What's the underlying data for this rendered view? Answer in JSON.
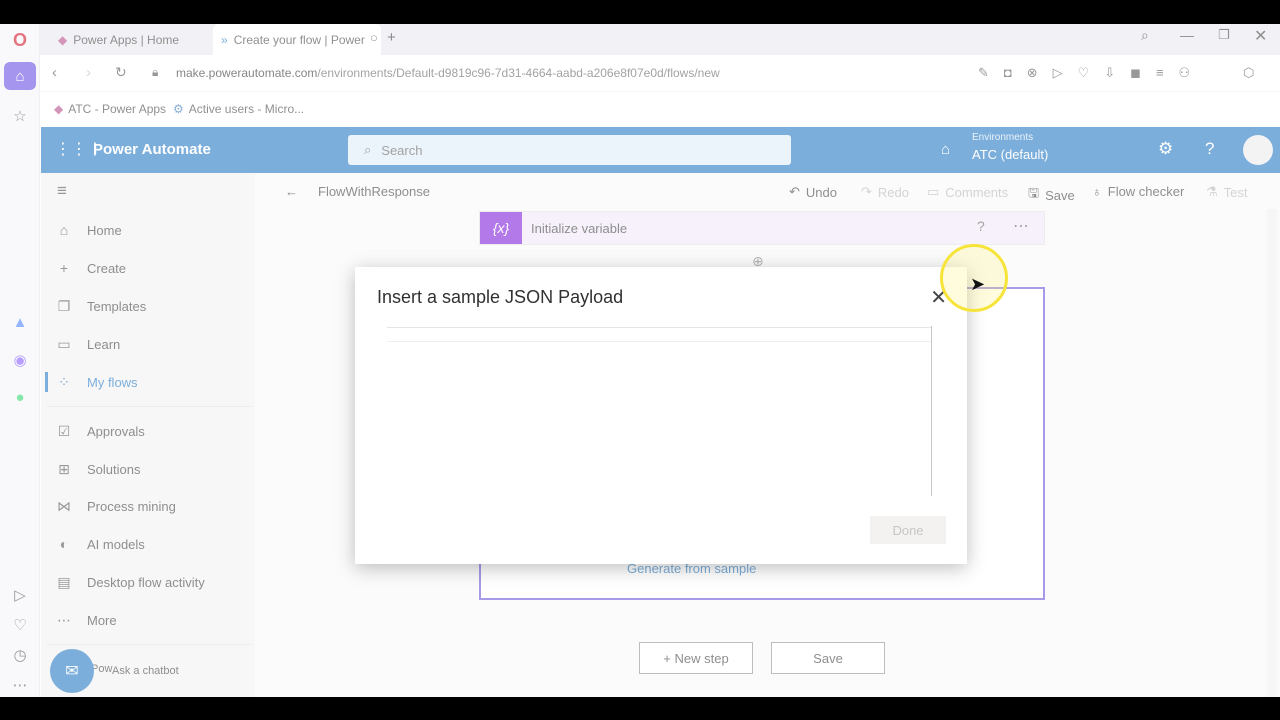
{
  "browser": {
    "tabs": [
      {
        "label": "Power Apps | Home"
      },
      {
        "label": "Create your flow | Power"
      }
    ],
    "url_domain": "make.powerautomate.com",
    "url_path": "/environments/Default-d9819c96-7d31-4664-aabd-a206e8f07e0d/flows/new",
    "bookmarks": [
      {
        "label": "ATC - Power Apps"
      },
      {
        "label": "Active users - Micro..."
      }
    ]
  },
  "header": {
    "app_name": "Power Automate",
    "search_placeholder": "Search",
    "env_label": "Environments",
    "env_value": "ATC (default)"
  },
  "nav": {
    "items": [
      {
        "label": "Home"
      },
      {
        "label": "Create"
      },
      {
        "label": "Templates"
      },
      {
        "label": "Learn"
      },
      {
        "label": "My flows"
      },
      {
        "label": "Approvals"
      },
      {
        "label": "Solutions"
      },
      {
        "label": "Process mining"
      },
      {
        "label": "AI models"
      },
      {
        "label": "Desktop flow activity"
      },
      {
        "label": "More"
      }
    ],
    "chatbot_label": "Ask a chatbot",
    "chatbot_prefix": "Pow"
  },
  "toolbar": {
    "flow_name": "FlowWithResponse",
    "undo": "Undo",
    "redo": "Redo",
    "comments": "Comments",
    "save": "Save",
    "flow_checker": "Flow checker",
    "test": "Test"
  },
  "canvas": {
    "init_card_title": "Initialize variable",
    "init_card_icon": "{x}",
    "generate_link": "Generate from sample",
    "new_step": "+ New step",
    "save_button": "Save"
  },
  "dialog": {
    "title": "Insert a sample JSON Payload",
    "done": "Done"
  }
}
